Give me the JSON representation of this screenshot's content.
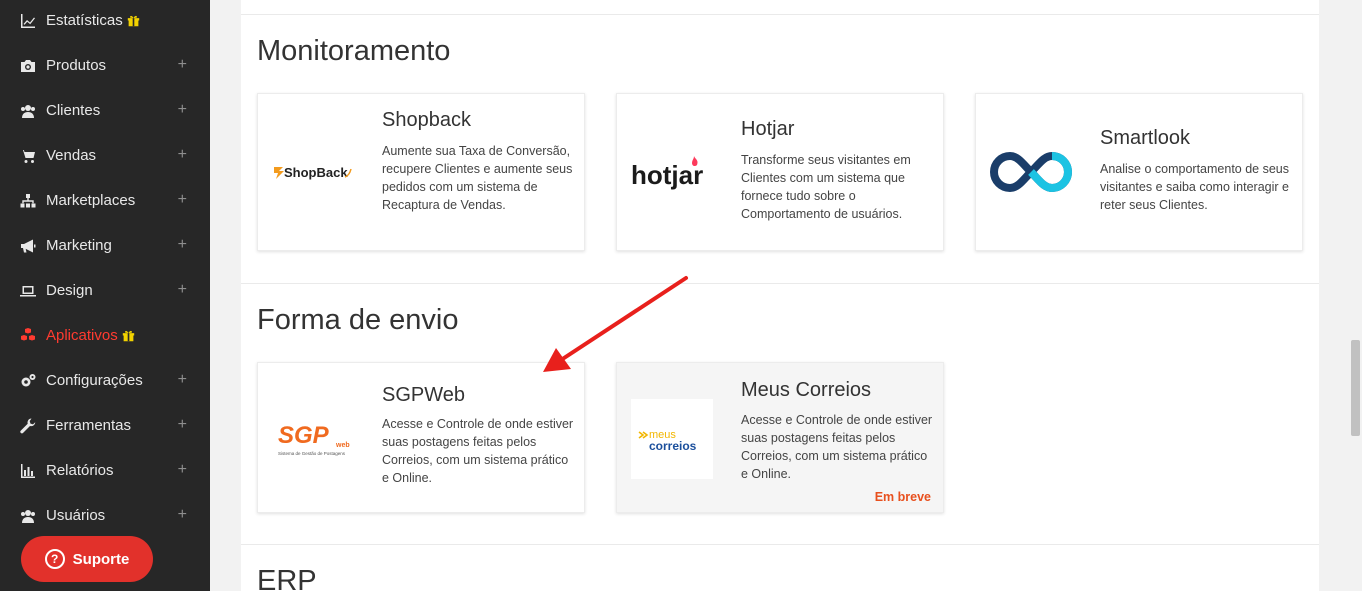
{
  "sidebar": {
    "items": [
      {
        "label": "Estatísticas",
        "gift": true,
        "plus": false
      },
      {
        "label": "Produtos",
        "gift": false,
        "plus": true
      },
      {
        "label": "Clientes",
        "gift": false,
        "plus": true
      },
      {
        "label": "Vendas",
        "gift": false,
        "plus": true
      },
      {
        "label": "Marketplaces",
        "gift": false,
        "plus": true
      },
      {
        "label": "Marketing",
        "gift": false,
        "plus": true
      },
      {
        "label": "Design",
        "gift": false,
        "plus": true
      },
      {
        "label": "Aplicativos",
        "gift": true,
        "plus": false,
        "active": true
      },
      {
        "label": "Configurações",
        "gift": false,
        "plus": true
      },
      {
        "label": "Ferramentas",
        "gift": false,
        "plus": true
      },
      {
        "label": "Relatórios",
        "gift": false,
        "plus": true
      },
      {
        "label": "Usuários",
        "gift": false,
        "plus": true
      }
    ],
    "plus_symbol": "+",
    "support_label": "Suporte",
    "support_icon": "?"
  },
  "sections": {
    "monitoramento": {
      "title": "Monitoramento",
      "cards": [
        {
          "name": "Shopback",
          "desc": "Aumente sua Taxa de Conversão, recupere Clientes e aumente seus pedidos com um sistema de Recaptura de Vendas.",
          "logo_text": "ShopBack"
        },
        {
          "name": "Hotjar",
          "desc": "Transforme seus visitantes em Clientes com um sistema que fornece tudo sobre o Comportamento de usuários.",
          "logo_text": "hotjar"
        },
        {
          "name": "Smartlook",
          "desc": "Analise o comportamento de seus visitantes e saiba como interagir e reter seus Clientes."
        }
      ]
    },
    "envio": {
      "title": "Forma de envio",
      "cards": [
        {
          "name": "SGPWeb",
          "desc": "Acesse e Controle de onde estiver suas postagens feitas pelos Correios, com um sistema prático e Online.",
          "logo_text": "SGP",
          "logo_sub": "web",
          "logo_caption": "Sistema de Gestão de Postagens"
        },
        {
          "name": "Meus Correios",
          "desc": "Acesse e Controle de onde estiver suas postagens feitas pelos Correios, com um sistema prático e Online.",
          "logo_text_1": "meus",
          "logo_text_2": "correios",
          "badge": "Em breve"
        }
      ]
    },
    "erp": {
      "title": "ERP"
    }
  },
  "colors": {
    "sidebar_bg": "#272727",
    "active": "#ff3b30",
    "support": "#e2312b",
    "arrow": "#e8201c",
    "soon": "#e8501e"
  }
}
